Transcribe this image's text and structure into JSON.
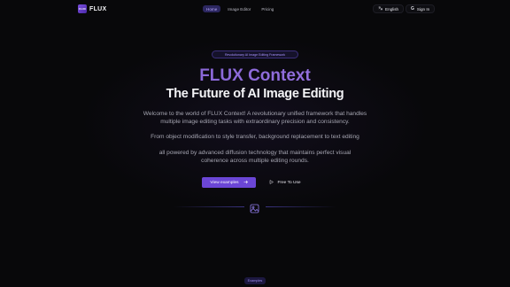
{
  "header": {
    "logo_mark": "FLUX",
    "logo_text": "FLUX",
    "nav": [
      {
        "label": "Home",
        "active": true
      },
      {
        "label": "Image Editor",
        "active": false
      },
      {
        "label": "Pricing",
        "active": false
      }
    ],
    "language_label": "English",
    "language_icon": "translate-icon",
    "signin_label": "Sign In",
    "signin_icon": "google-icon"
  },
  "hero": {
    "badge": "Revolutionary AI Image Editing Framework",
    "title": "FLUX Context",
    "subtitle": "The Future of AI Image Editing",
    "paragraph_1": "Welcome to the world of FLUX Context! A revolutionary unified framework that handles multiple image editing tasks with extraordinary precision and consistency.",
    "paragraph_2": "From object modification to style transfer, background replacement to text editing",
    "paragraph_3": "all powered by advanced diffusion technology that maintains perfect visual coherence across multiple editing rounds.",
    "primary_button": "View examples",
    "primary_button_icon": "arrow-right-icon",
    "secondary_button": "Free To Use",
    "secondary_button_icon": "play-icon"
  },
  "section": {
    "divider_icon": "image-icon",
    "examples_tag": "Examples"
  },
  "colors": {
    "accent": "#6b46d6",
    "background": "#08080a",
    "title_gradient_start": "#7d5bd0",
    "title_gradient_end": "#a07ce6"
  }
}
